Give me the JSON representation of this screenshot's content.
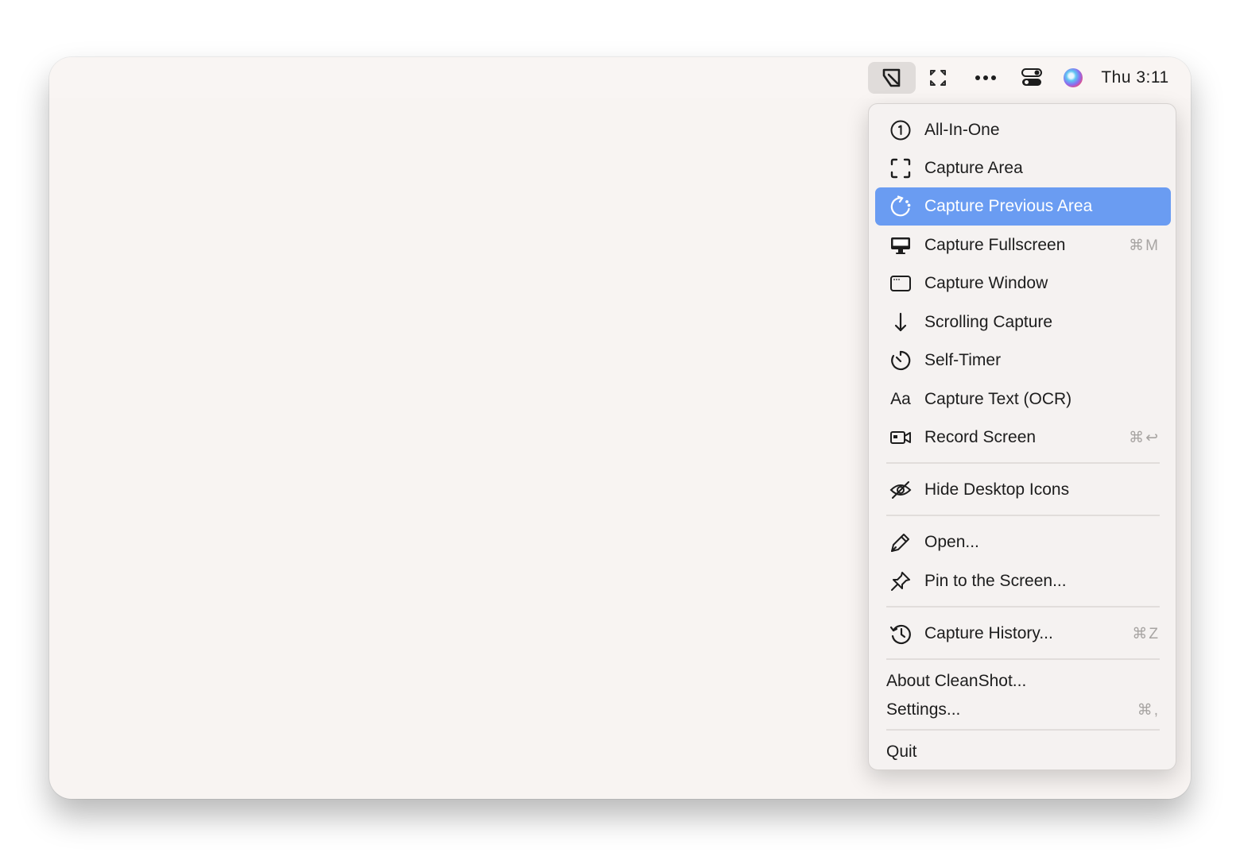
{
  "menubar": {
    "clock": "Thu 3:11",
    "icons": [
      "cleanshot-app-icon",
      "expand-arrows-icon",
      "more-dots-icon",
      "control-center-icon",
      "siri-icon"
    ]
  },
  "menu": {
    "items": [
      {
        "label": "All-In-One",
        "icon": "circle-one-icon",
        "shortcut": ""
      },
      {
        "label": "Capture Area",
        "icon": "capture-area-icon",
        "shortcut": ""
      },
      {
        "label": "Capture Previous Area",
        "icon": "previous-area-icon",
        "shortcut": "",
        "selected": true
      },
      {
        "label": "Capture Fullscreen",
        "icon": "monitor-icon",
        "shortcut": "⌘M"
      },
      {
        "label": "Capture Window",
        "icon": "window-icon",
        "shortcut": ""
      },
      {
        "label": "Scrolling Capture",
        "icon": "arrow-down-icon",
        "shortcut": ""
      },
      {
        "label": "Self-Timer",
        "icon": "timer-icon",
        "shortcut": ""
      },
      {
        "label": "Capture Text (OCR)",
        "icon": "text-aa-icon",
        "icon_text": "Aa",
        "shortcut": ""
      },
      {
        "label": "Record Screen",
        "icon": "video-camera-icon",
        "shortcut": "⌘↩"
      },
      {
        "label": "Hide Desktop Icons",
        "icon": "eye-slash-icon",
        "shortcut": ""
      },
      {
        "label": "Open...",
        "icon": "pencil-icon",
        "shortcut": ""
      },
      {
        "label": "Pin to the Screen...",
        "icon": "pin-icon",
        "shortcut": ""
      },
      {
        "label": "Capture History...",
        "icon": "history-icon",
        "shortcut": "⌘Z"
      },
      {
        "label": "About CleanShot...",
        "shortcut": ""
      },
      {
        "label": "Settings...",
        "shortcut": "⌘,"
      },
      {
        "label": "Quit",
        "shortcut": ""
      }
    ]
  },
  "colors": {
    "highlight": "#6a9cf2",
    "window_bg": "#f8f4f2",
    "menu_bg": "#f5f2f1"
  }
}
